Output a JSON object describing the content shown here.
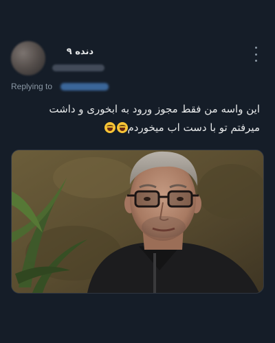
{
  "author": {
    "display_name": "دنده ۹"
  },
  "reply": {
    "label": "Replying to"
  },
  "tweet": {
    "text_line1": "این واسه من فقط مجوز ورود به ابخوری و داشت",
    "text_line2": "میرفتم تو با دست اب میخوردم"
  },
  "icons": {
    "more": "more-vertical-icon",
    "emoji": "grinning-squinting-face-emoji"
  },
  "colors": {
    "background": "#151d28",
    "text": "#e7e9ea",
    "secondary_text": "#8b98a5",
    "link": "#1d9bf0"
  }
}
